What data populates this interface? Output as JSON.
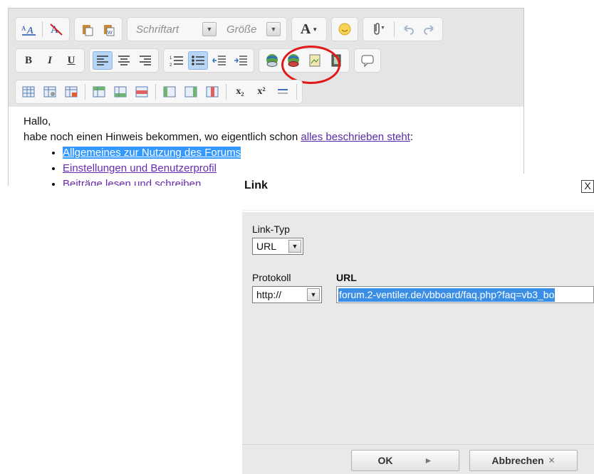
{
  "toolbar": {
    "font_combo": "Schriftart",
    "size_combo": "Größe",
    "bold": "B",
    "italic": "I",
    "underline": "U",
    "text_color": "A",
    "subscript": "x₂",
    "superscript": "x²"
  },
  "content": {
    "greeting": "Hallo,",
    "line_text": "habe noch einen Hinweis bekommen, wo eigentlich schon ",
    "line_link": "alles beschrieben steht",
    "line_end": ":",
    "items": [
      "Allgemeines zur Nutzung des Forums",
      "Einstellungen und Benutzerprofil",
      "Beiträge lesen und schreiben"
    ]
  },
  "dialog": {
    "title": "Link",
    "close": "X",
    "link_type_label": "Link-Typ",
    "link_type_value": "URL",
    "protocol_label": "Protokoll",
    "protocol_value": "http://",
    "url_label": "URL",
    "url_value": "forum.2-ventiler.de/vbboard/faq.php?faq=vb3_bo",
    "ok": "OK",
    "cancel": "Abbrechen"
  },
  "colors": {
    "highlight_ring": "#e01a1a",
    "selection": "#3399ff",
    "link": "#5a2aa8"
  }
}
